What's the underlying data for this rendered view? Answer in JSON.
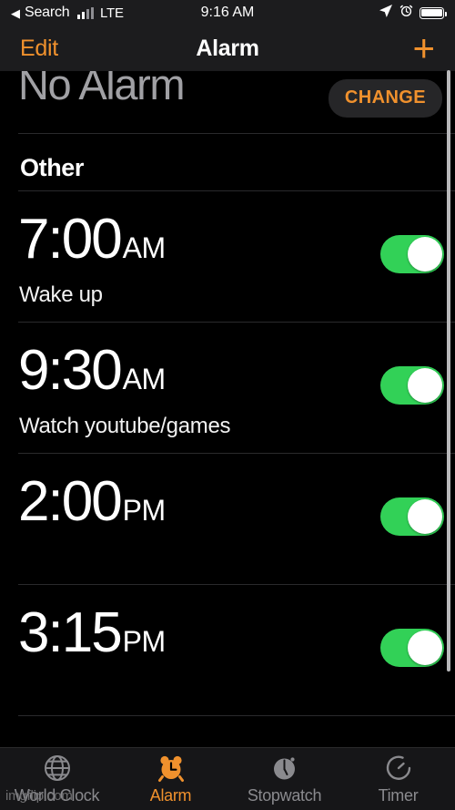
{
  "status_bar": {
    "back_arrow": "◀",
    "carrier_app": "Search",
    "network": "LTE",
    "time": "9:16 AM",
    "icons": [
      "location-arrow-icon",
      "alarm-icon",
      "battery-icon"
    ],
    "signal_bars_filled": 2,
    "signal_bars_total": 4,
    "battery_level_percent": 100
  },
  "nav_bar": {
    "edit_label": "Edit",
    "title": "Alarm",
    "add_label": "+"
  },
  "bedtime": {
    "title": "No Alarm",
    "change_label": "CHANGE"
  },
  "section": {
    "header": "Other"
  },
  "alarms": [
    {
      "time": "7:00",
      "meridiem": "AM",
      "label": "Wake up",
      "enabled": true,
      "label_visible": true
    },
    {
      "time": "9:30",
      "meridiem": "AM",
      "label": "Watch youtube/games",
      "enabled": true,
      "label_visible": true
    },
    {
      "time": "2:00",
      "meridiem": "PM",
      "label": "",
      "enabled": true,
      "label_visible": false
    },
    {
      "time": "3:15",
      "meridiem": "PM",
      "label": "",
      "enabled": true,
      "label_visible": false
    }
  ],
  "tabs": [
    {
      "label": "World Clock",
      "icon": "globe-icon",
      "active": false
    },
    {
      "label": "Alarm",
      "icon": "alarm-clock-icon",
      "active": true
    },
    {
      "label": "Stopwatch",
      "icon": "stopwatch-icon",
      "active": false
    },
    {
      "label": "Timer",
      "icon": "timer-icon",
      "active": false
    }
  ],
  "watermark": "imgflip.com",
  "colors": {
    "accent_orange": "#f0912d",
    "toggle_green": "#32d157",
    "background": "#000000",
    "bar_background": "#1c1c1e",
    "inactive_gray": "#8a8a8e"
  }
}
